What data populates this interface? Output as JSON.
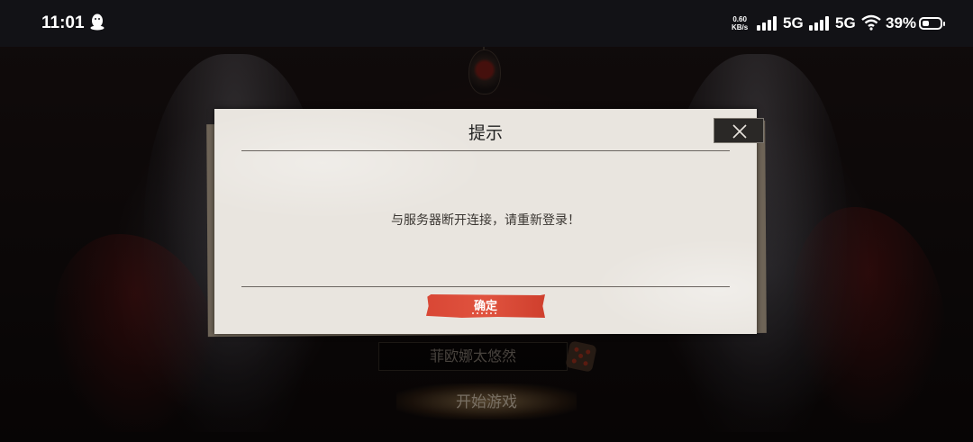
{
  "status_bar": {
    "time": "11:01",
    "qq_icon": "penguin-icon",
    "net_speed_value": "0.60",
    "net_speed_unit": "KB/s",
    "sim1_label": "5G",
    "sim2_label": "5G",
    "battery_percent": "39%",
    "battery_level": 0.39
  },
  "lobby": {
    "player_name": "菲欧娜太悠然",
    "dice_icon": "dice-icon",
    "start_label": "开始游戏"
  },
  "dialog": {
    "title": "提示",
    "message": "与服务器断开连接，请重新登录！",
    "confirm_label": "确定",
    "close_icon": "close-icon"
  },
  "colors": {
    "confirm_red": "#dd4b37",
    "dialog_paper": "#e9e5df",
    "status_bar_bg": "#121216"
  }
}
